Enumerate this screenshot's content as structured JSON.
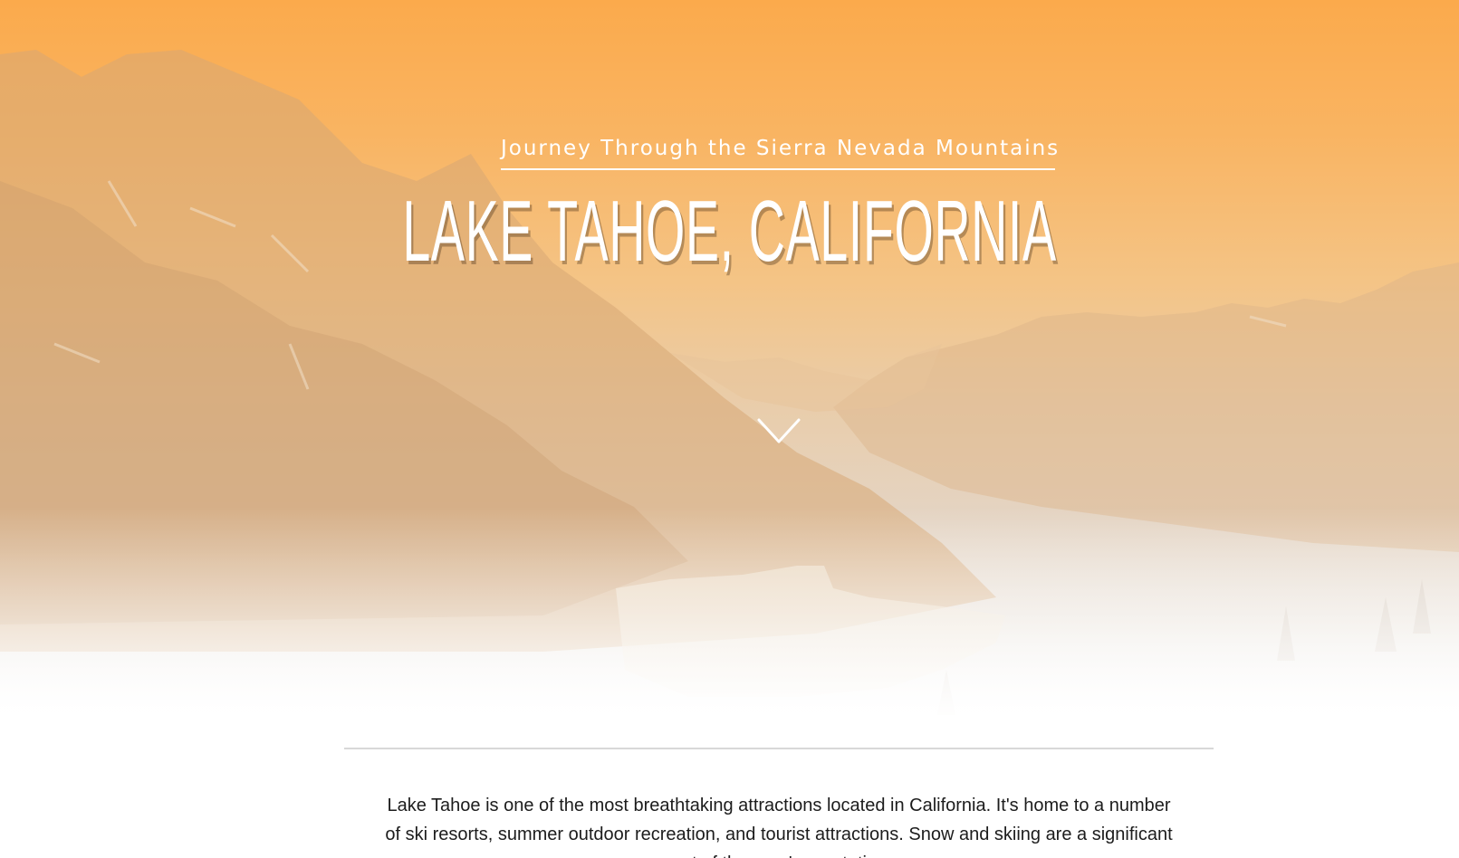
{
  "hero": {
    "subtitle": "Journey Through the Sierra Nevada Mountains",
    "title": "LAKE TAHOE, CALIFORNIA",
    "scroll_icon": "chevron-down-icon",
    "colors": {
      "sky_top": "#fbaa4c",
      "haze": "#e4d4c3",
      "text": "#ffffff"
    }
  },
  "intro": {
    "text": "Lake Tahoe is one of the most breathtaking attractions located in California. It's home to a number of ski resorts, summer outdoor recreation, and tourist attractions. Snow and skiing are a significant part of the area's reputation."
  }
}
